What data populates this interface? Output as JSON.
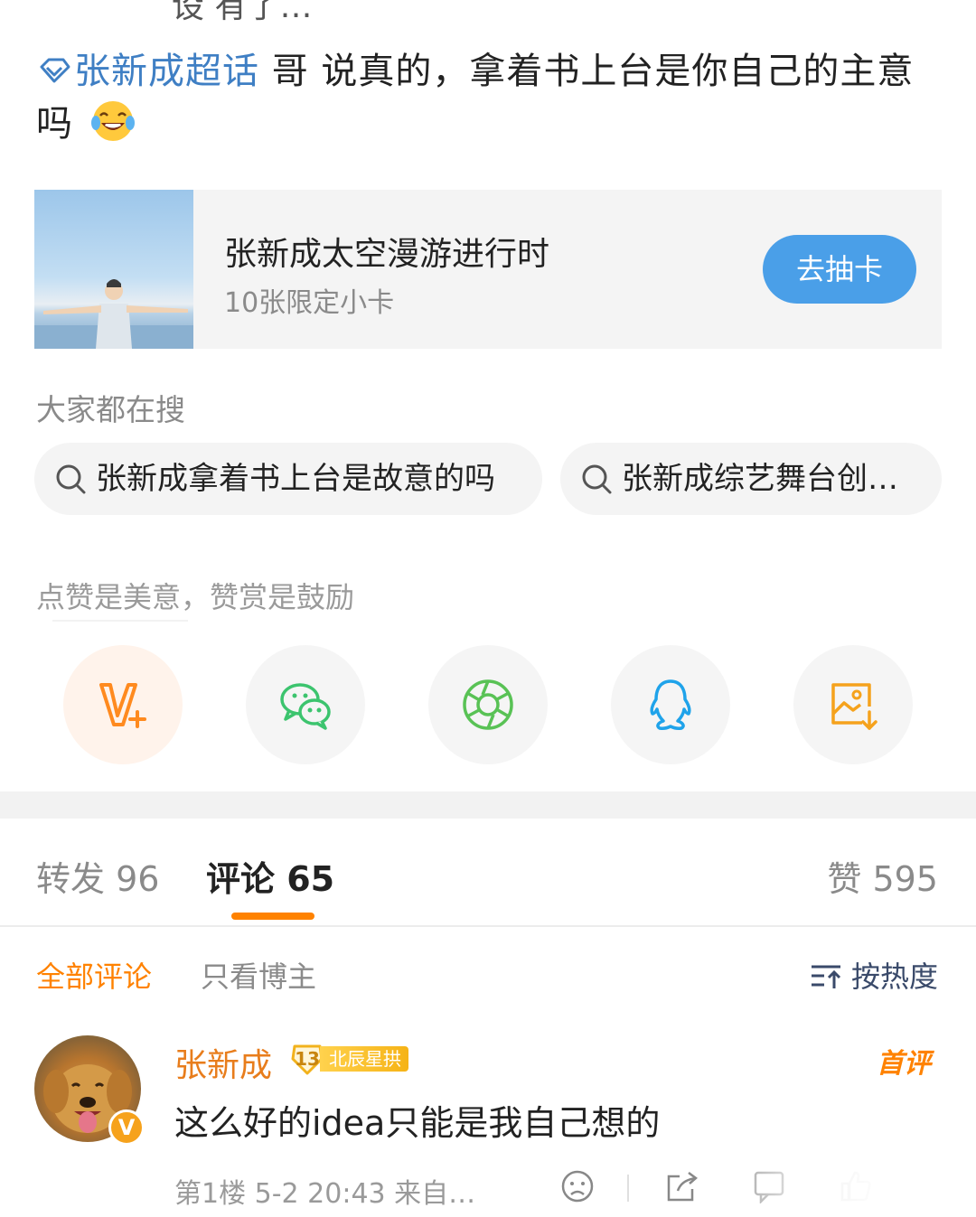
{
  "top_cutoff_text": "设 有了…",
  "post": {
    "topic": "张新成超话",
    "text": " 哥 说真的，拿着书上台是你自己的主意吗",
    "emoji": "laughing-tears-emoji"
  },
  "card": {
    "title": "张新成太空漫游进行时",
    "subtitle": "10张限定小卡",
    "button": "去抽卡"
  },
  "searches": {
    "title": "大家都在搜",
    "items": [
      "张新成拿着书上台是故意的吗",
      "张新成综艺舞台创…"
    ]
  },
  "share": {
    "title": "点赞是美意，赞赏是鼓励",
    "buttons": [
      "v-plus-icon",
      "wechat-icon",
      "moments-icon",
      "qq-icon",
      "save-image-icon"
    ]
  },
  "tabs": {
    "repost": "转发 96",
    "comment": "评论 65",
    "like": "赞 595"
  },
  "filters": {
    "all": "全部评论",
    "author_only": "只看博主",
    "sort": "按热度"
  },
  "comment": {
    "username": "张新成",
    "level": "13",
    "badge": "北辰星拱",
    "verified": "V",
    "tag": "首评",
    "text": "这么好的idea只能是我自己想的",
    "meta": "第1楼 5-2 20:43 来自…"
  },
  "colors": {
    "accent": "#ff8200",
    "link": "#3f7fc4",
    "button_blue": "#4a9fe8"
  }
}
